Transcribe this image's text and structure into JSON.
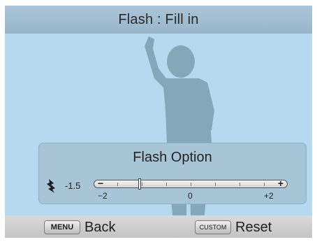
{
  "header": {
    "title": "Flash : Fill in"
  },
  "flash_option": {
    "title": "Flash Option",
    "icon": "flash-icon",
    "current_value": "-1.5",
    "current_level": -1.5,
    "range": [
      -2,
      2
    ],
    "minus_symbol": "−",
    "plus_symbol": "+",
    "scale_labels": {
      "min": "−2",
      "mid": "0",
      "max": "+2"
    }
  },
  "footer": {
    "back": {
      "key": "MENU",
      "label": "Back"
    },
    "reset": {
      "key": "CUSTOM",
      "label": "Reset"
    }
  },
  "colors": {
    "background": "#b6d9ef",
    "silhouette": "#7e9eb0",
    "panel": "#a8c5d8"
  }
}
